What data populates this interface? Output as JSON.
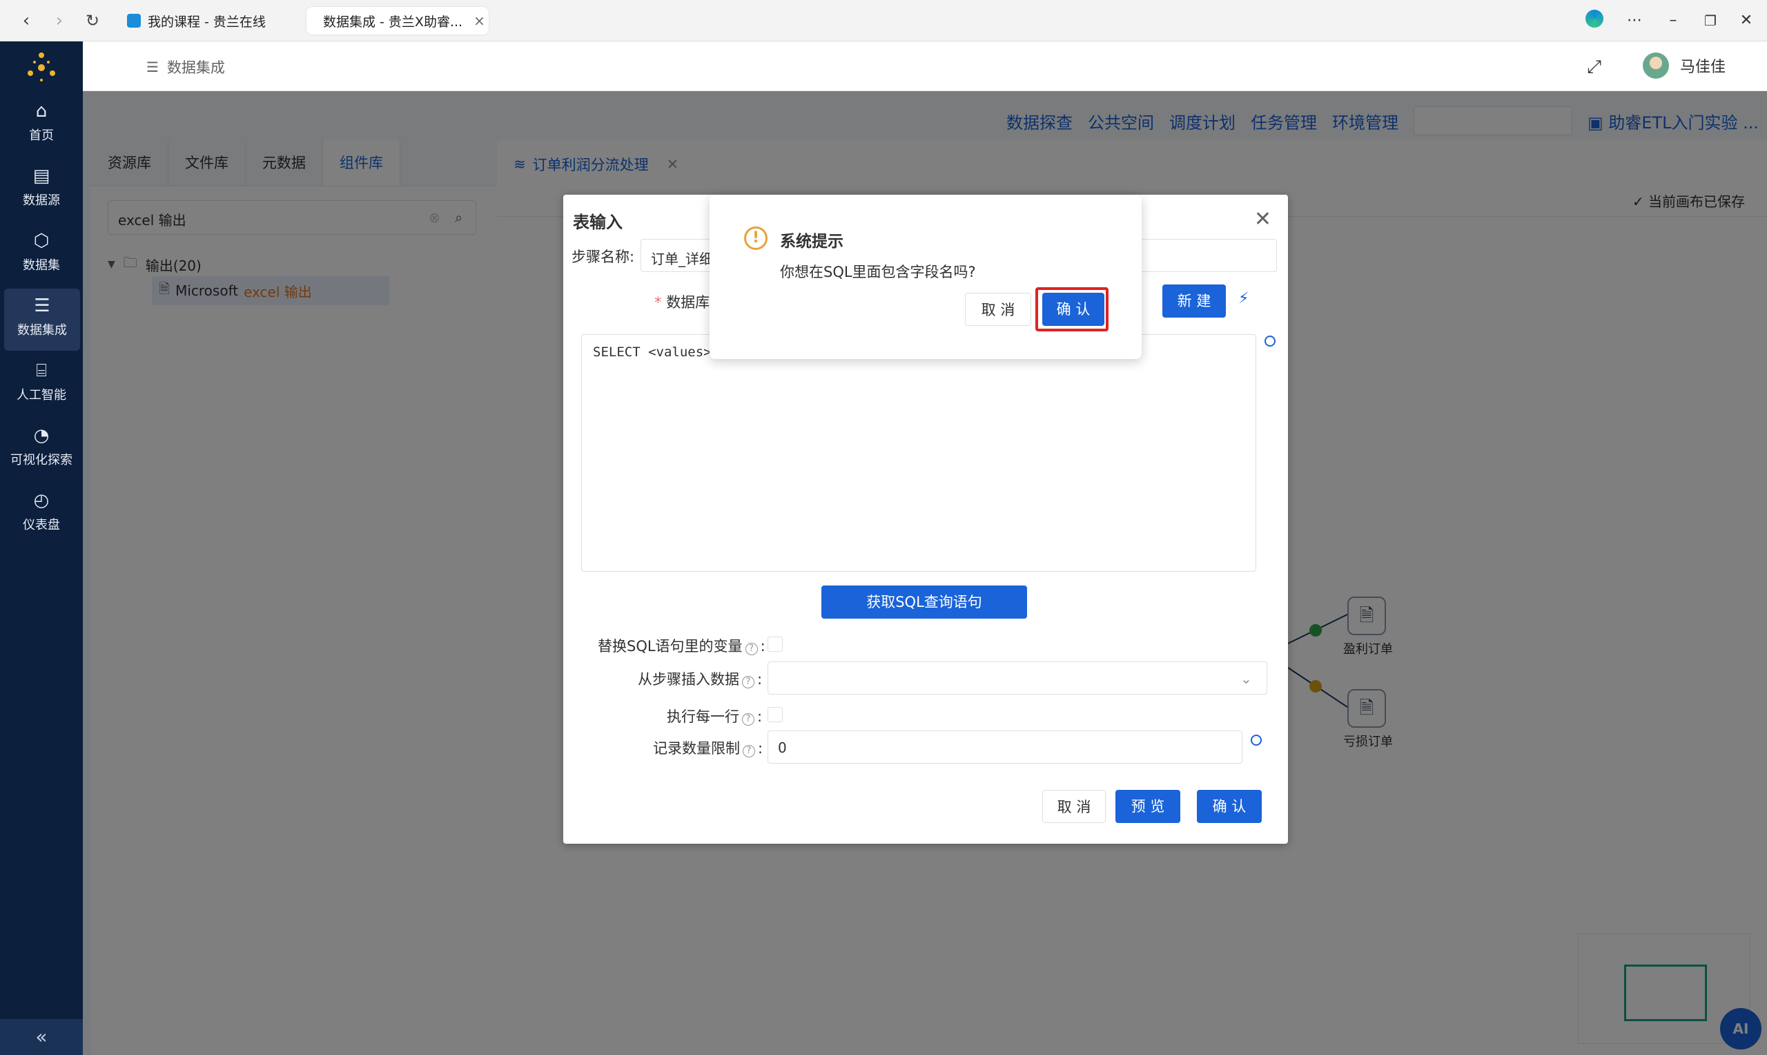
{
  "browser": {
    "tabs": [
      {
        "title": "我的课程 - 贵兰在线",
        "active": false
      },
      {
        "title": "数据集成 - 贵兰X助睿...",
        "active": true
      }
    ]
  },
  "sidebar": {
    "items": [
      {
        "label": "首页",
        "icon": "home-icon"
      },
      {
        "label": "数据源",
        "icon": "database-icon"
      },
      {
        "label": "数据集",
        "icon": "cube-icon"
      },
      {
        "label": "数据集成",
        "icon": "server-icon",
        "active": true
      },
      {
        "label": "人工智能",
        "icon": "ai-icon"
      },
      {
        "label": "可视化探索",
        "icon": "pie-chart-icon"
      },
      {
        "label": "仪表盘",
        "icon": "gauge-icon"
      }
    ],
    "collapse": "«"
  },
  "header": {
    "breadcrumb": "数据集成",
    "user_name": "马佳佳"
  },
  "topnav": {
    "links": [
      "数据探查",
      "公共空间",
      "调度计划",
      "任务管理",
      "环境管理"
    ],
    "project": "助睿ETL入门实验 ..."
  },
  "left_panel": {
    "tabs": [
      "资源库",
      "文件库",
      "元数据",
      "组件库"
    ],
    "active_tab": "组件库",
    "search_value": "excel 输出",
    "tree_group": "输出(20)",
    "tree_item_prefix": "Microsoft ",
    "tree_item_highlight": "excel 输出"
  },
  "canvas": {
    "tab_title": "订单利润分流处理",
    "saved_status": "当前画布已保存",
    "node_profit": "盈利订单",
    "node_loss": "亏损订单"
  },
  "dialog": {
    "title": "表输入",
    "step_name_label": "步骤名称:",
    "step_name_value": "订单_详细",
    "database_label": "数据库",
    "new_button": "新 建",
    "sql_value": "SELECT <values> F",
    "get_sql_button": "获取SQL查询语句",
    "replace_vars_label": "替换SQL语句里的变量",
    "insert_from_step_label": "从步骤插入数据",
    "exec_each_row_label": "执行每一行",
    "record_limit_label": "记录数量限制",
    "record_limit_value": "0",
    "cancel_button": "取 消",
    "preview_button": "预 览",
    "confirm_button": "确 认"
  },
  "confirm_popup": {
    "title": "系统提示",
    "message": "你想在SQL里面包含字段名吗?",
    "cancel": "取 消",
    "ok": "确 认"
  },
  "colors": {
    "primary": "#1a63d8",
    "sidebar_bg": "#0c1f3d",
    "warning": "#e6a23c",
    "highlight_border": "#e02323"
  }
}
